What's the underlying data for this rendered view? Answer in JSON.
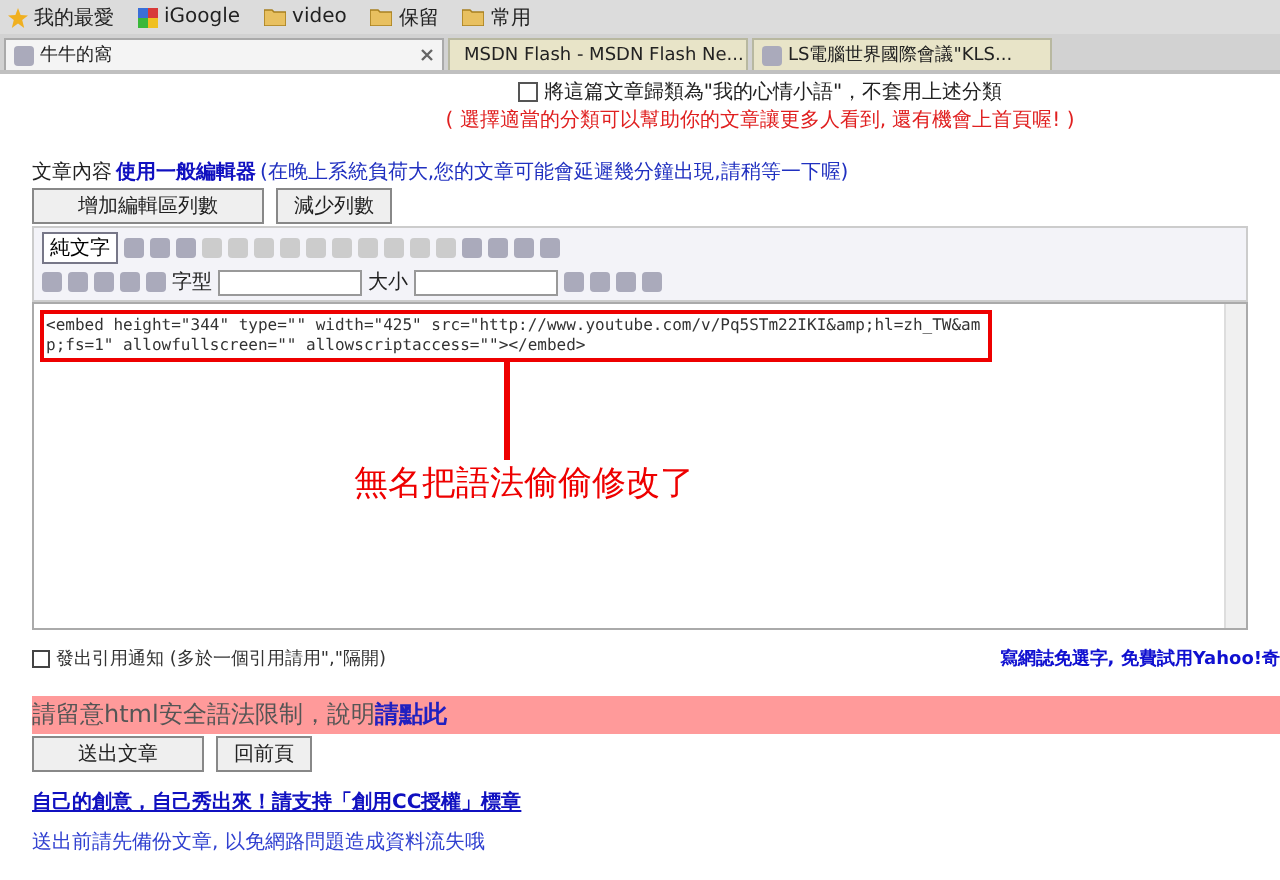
{
  "bookmarks": [
    {
      "label": "我的最愛",
      "kind": "star"
    },
    {
      "label": "iGoogle",
      "kind": "google"
    },
    {
      "label": "video",
      "kind": "folder"
    },
    {
      "label": "保留",
      "kind": "folder"
    },
    {
      "label": "常用",
      "kind": "folder"
    }
  ],
  "tabs": [
    {
      "label": "牛牛的窩",
      "selected": true
    },
    {
      "label": "MSDN Flash - MSDN Flash Ne...",
      "selected": false
    },
    {
      "label": "LS電腦世界國際會議\"KLS...",
      "selected": false
    }
  ],
  "category_option": {
    "label": "將這篇文章歸類為\"我的心情小語\"，不套用上述分類",
    "checked": false
  },
  "category_hint": "( 選擇適當的分類可以幫助你的文章讓更多人看到, 還有機會上首頁喔! )",
  "content_label": "文章內容",
  "editor_link": "使用一般編輯器",
  "editor_note": "(在晚上系統負荷大,您的文章可能會延遲幾分鐘出現,請稍等一下喔)",
  "row_buttons": [
    "增加編輯區列數",
    "減少列數"
  ],
  "toolbar": {
    "plain_text_button": "純文字",
    "font_label": "字型",
    "size_label": "大小"
  },
  "editor": {
    "code": "<embed height=\"344\" type=\"\" width=\"425\" src=\"http://www.youtube.com/v/Pq5STm22IKI&amp;hl=zh_TW&amp;fs=1\" allowfullscreen=\"\" allowscriptaccess=\"\"></embed>"
  },
  "annotation": "無名把語法偷偷修改了",
  "trackback": "發出引用通知 (多於一個引用請用\",\"隔開)",
  "yahoo_link": "寫網誌免選字, 免費試用Yahoo!奇",
  "banner": {
    "text": "請留意html安全語法限制，說明",
    "link": "請點此"
  },
  "submit_buttons": [
    "送出文章",
    "回前頁"
  ],
  "cc_link": "自己的創意，自己秀出來！請支持「創用CC授權」標章",
  "backup_note": "送出前請先備份文章, 以免網路問題造成資料流失哦"
}
